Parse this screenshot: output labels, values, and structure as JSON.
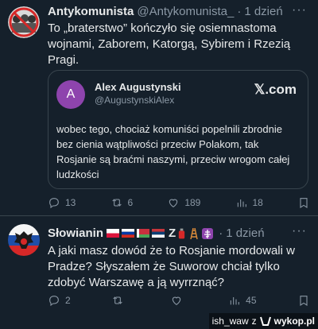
{
  "post1": {
    "author": "Antykomunista",
    "handle": "@Antykomunista_",
    "separator": "·",
    "time": "1 dzień",
    "more": "···",
    "text": "To „braterstwo” kończyło się osiemnastoma wojnami, Zaborem, Katorgą, Sybirem i Rzezią Pragi.",
    "quote": {
      "avatar_letter": "A",
      "author": "Alex Augustynski",
      "handle": "@AugustynskiAlex",
      "platform": "𝕏.com",
      "text": "wobec tego, chociaż komuniści popelnili zbrodnie bez cienia wątpliwości przeciw Polakom, tak Rosjanie są braćmi naszymi, przeciw wrogom całej ludzkości"
    },
    "actions": {
      "replies": "13",
      "reposts": "6",
      "likes": "189",
      "views": "18"
    }
  },
  "post2": {
    "author": "Słowianin",
    "extra_glyphs": "Z",
    "separator": "·",
    "time": "1 dzień",
    "more": "···",
    "text": "A jaki masz dowód że to Rosjanie mordowali w Pradze? Słyszałem że Suworow chciał tylko zdobyć Warszawę a ją wyrrznąć?",
    "actions": {
      "replies": "2",
      "reposts": "",
      "likes": "",
      "views": "45"
    }
  },
  "watermark": {
    "user": "ish_waw",
    "prefix": "z",
    "brand": "wykop.pl"
  },
  "colors": {
    "background": "#15202b",
    "text": "#e7e9ea",
    "muted": "#8b98a5",
    "border": "#38444d",
    "quote_avatar": "#8e44ad"
  }
}
